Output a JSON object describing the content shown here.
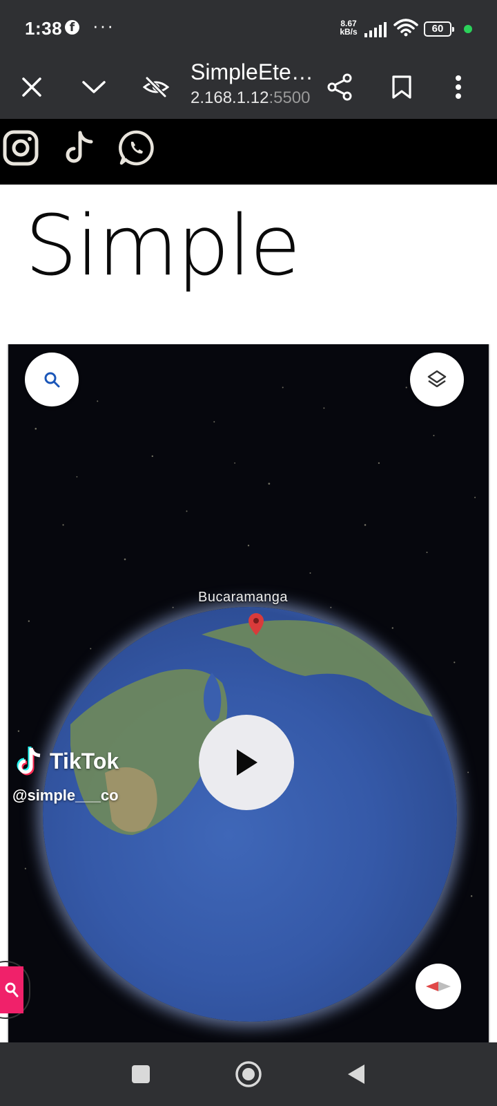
{
  "status_bar": {
    "time": "1:38",
    "notification_icon": "facebook-icon",
    "more_indicator": "···",
    "net_speed_value": "8.67",
    "net_speed_unit": "kB/s",
    "battery_level": "60",
    "indicator_color": "#2bd15a"
  },
  "browser_toolbar": {
    "page_title": "SimpleEte…",
    "url_host": "2.168.1.12",
    "url_port": ":5500",
    "icons": [
      "close-icon",
      "chevron-down-icon",
      "eye-off-icon",
      "share-icon",
      "bookmark-icon",
      "more-vertical-icon"
    ]
  },
  "social_bar": {
    "icons": [
      "instagram-icon",
      "tiktok-icon",
      "whatsapp-icon"
    ]
  },
  "logo": {
    "text": "Simple"
  },
  "video": {
    "place_label": "Bucaramanga",
    "overlay_brand": "TikTok",
    "overlay_handle": "@simple___co",
    "controls": [
      "search-icon",
      "layers-icon",
      "play-icon",
      "compass-icon"
    ]
  },
  "nav_bar": {
    "buttons": [
      "recents-icon",
      "home-icon",
      "back-icon"
    ]
  },
  "colors": {
    "chrome": "#2f3033",
    "accent_pink": "#f0216a"
  }
}
